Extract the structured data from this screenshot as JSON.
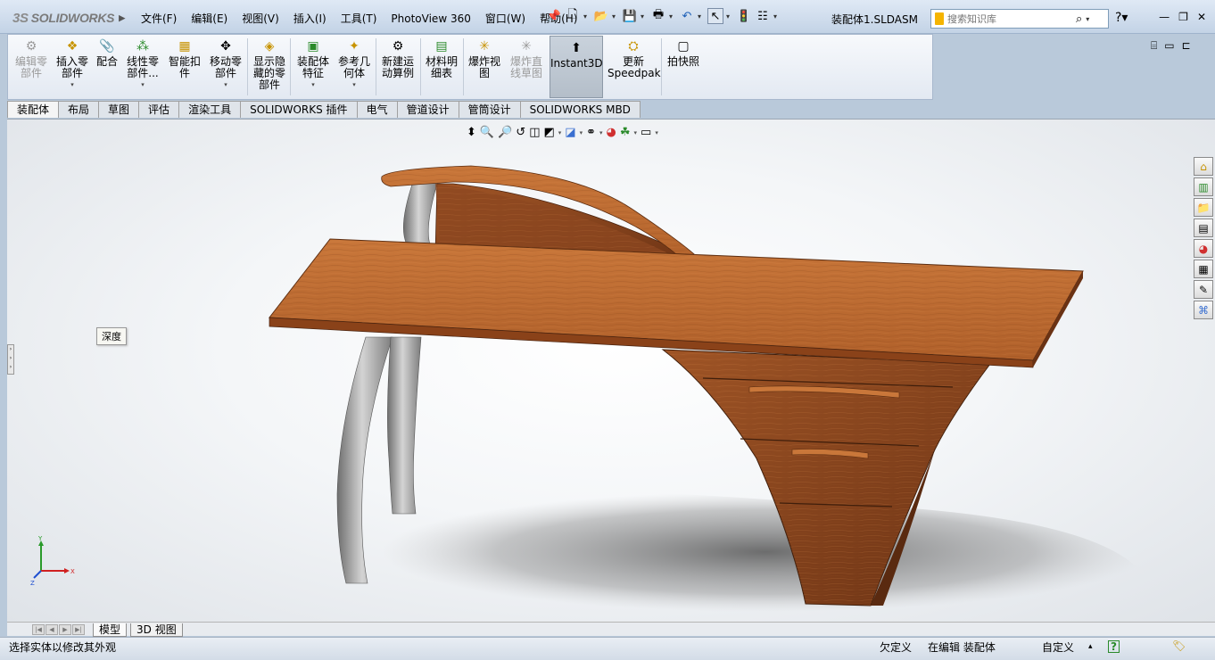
{
  "app": {
    "logo_text": "SOLIDWORKS",
    "logo_mark": "3S",
    "document_title": "装配体1.SLDASM"
  },
  "menus": [
    "文件(F)",
    "编辑(E)",
    "视图(V)",
    "插入(I)",
    "工具(T)",
    "PhotoView 360",
    "窗口(W)",
    "帮助(H)"
  ],
  "search": {
    "placeholder": "搜索知识库"
  },
  "commands": [
    {
      "label1": "编辑零",
      "label2": "部件",
      "label3": "",
      "icon": "edit-component-icon",
      "disabled": true
    },
    {
      "label1": "插入零",
      "label2": "部件",
      "label3": "",
      "icon": "insert-component-icon",
      "disabled": false
    },
    {
      "label1": "配合",
      "label2": "",
      "label3": "",
      "icon": "mate-icon",
      "disabled": false
    },
    {
      "label1": "线性零",
      "label2": "部件...",
      "label3": "",
      "icon": "linear-pattern-icon",
      "disabled": false
    },
    {
      "label1": "智能扣",
      "label2": "件",
      "label3": "",
      "icon": "smart-fasteners-icon",
      "disabled": false
    },
    {
      "label1": "移动零",
      "label2": "部件",
      "label3": "",
      "icon": "move-component-icon",
      "disabled": false
    },
    {
      "label1": "显示隐",
      "label2": "藏的零",
      "label3": "部件",
      "icon": "show-hidden-icon",
      "disabled": false
    },
    {
      "label1": "装配体",
      "label2": "特征",
      "label3": "",
      "icon": "assembly-features-icon",
      "disabled": false
    },
    {
      "label1": "参考几",
      "label2": "何体",
      "label3": "",
      "icon": "reference-geometry-icon",
      "disabled": false
    },
    {
      "label1": "新建运",
      "label2": "动算例",
      "label3": "",
      "icon": "new-motion-study-icon",
      "disabled": false
    },
    {
      "label1": "材料明",
      "label2": "细表",
      "label3": "",
      "icon": "bom-icon",
      "disabled": false
    },
    {
      "label1": "爆炸视",
      "label2": "图",
      "label3": "",
      "icon": "exploded-view-icon",
      "disabled": false
    },
    {
      "label1": "爆炸直",
      "label2": "线草图",
      "label3": "",
      "icon": "explode-line-sketch-icon",
      "disabled": true
    },
    {
      "label1": "Instant3D",
      "label2": "",
      "label3": "",
      "icon": "instant3d-icon",
      "disabled": false
    },
    {
      "label1": "更新",
      "label2": "Speedpak",
      "label3": "",
      "icon": "speedpak-icon",
      "disabled": false
    },
    {
      "label1": "拍快照",
      "label2": "",
      "label3": "",
      "icon": "snapshot-icon",
      "disabled": false
    }
  ],
  "tabs": [
    "装配体",
    "布局",
    "草图",
    "评估",
    "渲染工具",
    "SOLIDWORKS 插件",
    "电气",
    "管道设计",
    "管筒设计",
    "SOLIDWORKS MBD"
  ],
  "tooltip": {
    "depth": "深度"
  },
  "triad": {
    "x": "X",
    "y": "Y",
    "z": "Z"
  },
  "model_tabs": [
    "模型",
    "3D 视图"
  ],
  "status": {
    "message": "选择实体以修改其外观",
    "definition": "欠定义",
    "editing": "在编辑 装配体",
    "units": "自定义"
  },
  "colors": {
    "wood": "#b5652e",
    "wood_dark": "#7a3a17",
    "metal": "#9a9a9a",
    "accent": "#f5b400"
  }
}
